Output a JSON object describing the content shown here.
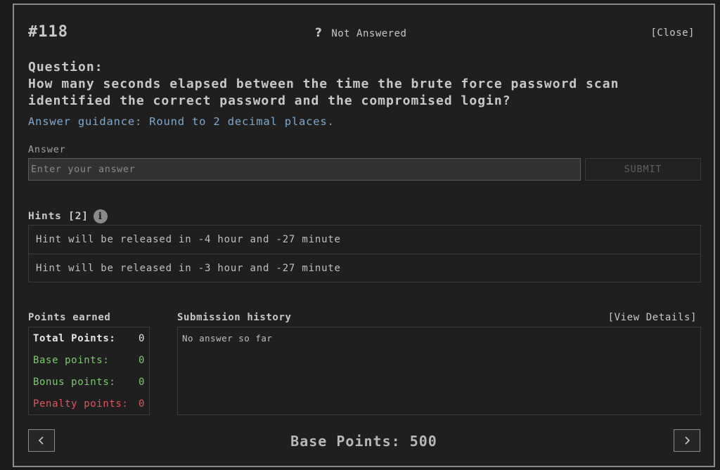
{
  "header": {
    "question_number": "#118",
    "status_icon": "question-mark-icon",
    "status_glyph": "?",
    "status_text": "Not Answered",
    "close_label": "[Close]"
  },
  "question": {
    "label": "Question:",
    "text": "How many seconds elapsed between the time the brute force password scan identified the correct password and the compromised login?",
    "guidance": "Answer guidance: Round to 2 decimal places."
  },
  "answer": {
    "label": "Answer",
    "value": "",
    "placeholder": "Enter your answer",
    "submit_label": "SUBMIT"
  },
  "hints": {
    "title": "Hints [2]",
    "info_glyph": "i",
    "items": [
      {
        "text": "Hint will be released in -4 hour and -27 minute"
      },
      {
        "text": "Hint will be released in -3 hour and -27 minute"
      }
    ]
  },
  "points": {
    "title": "Points earned",
    "total_label": "Total Points:",
    "total_value": "0",
    "base_label": "Base points:",
    "base_value": "0",
    "bonus_label": "Bonus points:",
    "bonus_value": "0",
    "penalty_label": "Penalty points:",
    "penalty_value": "0"
  },
  "submissions": {
    "title": "Submission history",
    "view_details_label": "[View Details]",
    "empty_text": "No answer so far"
  },
  "footer": {
    "base_points_text": "Base Points: 500",
    "prev_icon": "chevron-left-icon",
    "next_icon": "chevron-right-icon"
  },
  "colors": {
    "background": "#1f1f1f",
    "text": "#c8c8c8",
    "guidance": "#7fa8cf",
    "positive": "#7ccb6e",
    "penalty": "#e2555f",
    "border": "#3a3a3a"
  }
}
